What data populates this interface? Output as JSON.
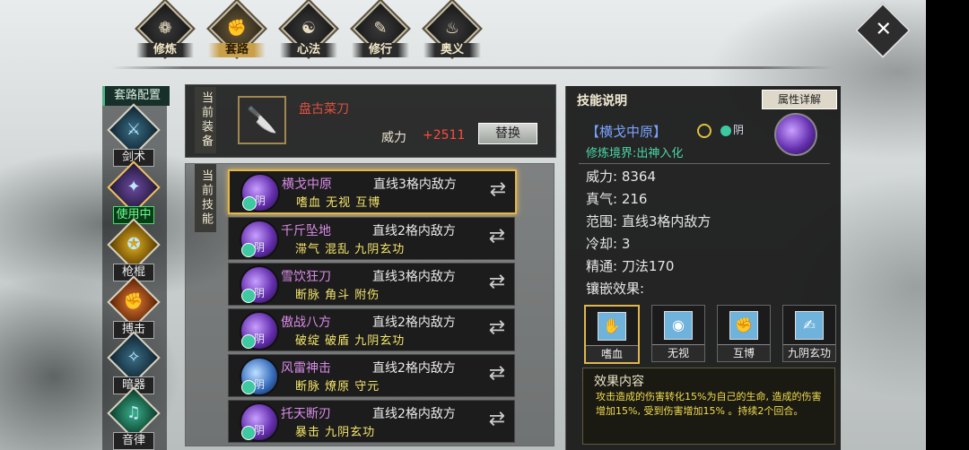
{
  "nav": {
    "tabs": [
      {
        "label": "修炼",
        "icon": "cultivate-icon",
        "active": false
      },
      {
        "label": "套路",
        "icon": "fist-icon",
        "active": true
      },
      {
        "label": "心法",
        "icon": "taiji-icon",
        "active": false
      },
      {
        "label": "修行",
        "icon": "scroll-icon",
        "active": false
      },
      {
        "label": "奥义",
        "icon": "flame-icon",
        "active": false
      }
    ],
    "close_symbol": "✕"
  },
  "sidebar": {
    "title": "套路配置",
    "categories": [
      {
        "label": "剑术",
        "icon": "sword-icon",
        "active": false
      },
      {
        "label": "使用中",
        "icon": "blade-icon",
        "active": true
      },
      {
        "label": "枪棍",
        "icon": "spear-icon",
        "active": false
      },
      {
        "label": "搏击",
        "icon": "fist-icon",
        "active": false
      },
      {
        "label": "暗器",
        "icon": "dart-icon",
        "active": false
      },
      {
        "label": "音律",
        "icon": "music-icon",
        "active": false
      }
    ]
  },
  "equipment": {
    "tab_label": "当前装备",
    "weapon_name": "盘古菜刀",
    "power_label": "威力",
    "power_value": "+2511",
    "swap_label": "替换"
  },
  "skills": {
    "tab_label": "当前技能",
    "yin_label": "阴",
    "list": [
      {
        "name": "横戈中原",
        "range": "直线3格内敌方",
        "effects": "嗜血 无视 互博",
        "selected": true
      },
      {
        "name": "千斤坠地",
        "range": "直线2格内敌方",
        "effects": "滞气 混乱 九阴玄功",
        "selected": false
      },
      {
        "name": "雪饮狂刀",
        "range": "直线3格内敌方",
        "effects": "断脉 角斗 附伤",
        "selected": false
      },
      {
        "name": "傲战八方",
        "range": "直线2格内敌方",
        "effects": "破绽 破盾 九阴玄功",
        "selected": false
      },
      {
        "name": "风雷神击",
        "range": "直线2格内敌方",
        "effects": "断脉 燎原 守元",
        "selected": false
      },
      {
        "name": "托天断刃",
        "range": "直线2格内敌方",
        "effects": "暴击 九阴玄功",
        "selected": false
      }
    ]
  },
  "detail": {
    "header": "技能说明",
    "attr_button": "属性详解",
    "name": "【横戈中原】",
    "yin_label": "阴",
    "realm": "修炼境界:出神入化",
    "stats": [
      {
        "text": "威力: 8364"
      },
      {
        "text": "真气: 216"
      },
      {
        "text": "范围: 直线3格内敌方"
      },
      {
        "text": "冷却: 3"
      },
      {
        "text": "精通: 刀法170"
      }
    ],
    "inlay_label": "镶嵌效果:",
    "gems": [
      {
        "label": "嗜血",
        "icon": "bloodthirst-icon",
        "selected": true
      },
      {
        "label": "无视",
        "icon": "eye-icon",
        "selected": false
      },
      {
        "label": "互博",
        "icon": "duel-icon",
        "selected": false
      },
      {
        "label": "九阴玄功",
        "icon": "book-icon",
        "selected": false
      }
    ],
    "effect_title": "效果内容",
    "effect_text": "攻击造成的伤害转化15%为自己的生命, 造成的伤害增加15%, 受到伤害增加15% 。持续2个回合。"
  }
}
